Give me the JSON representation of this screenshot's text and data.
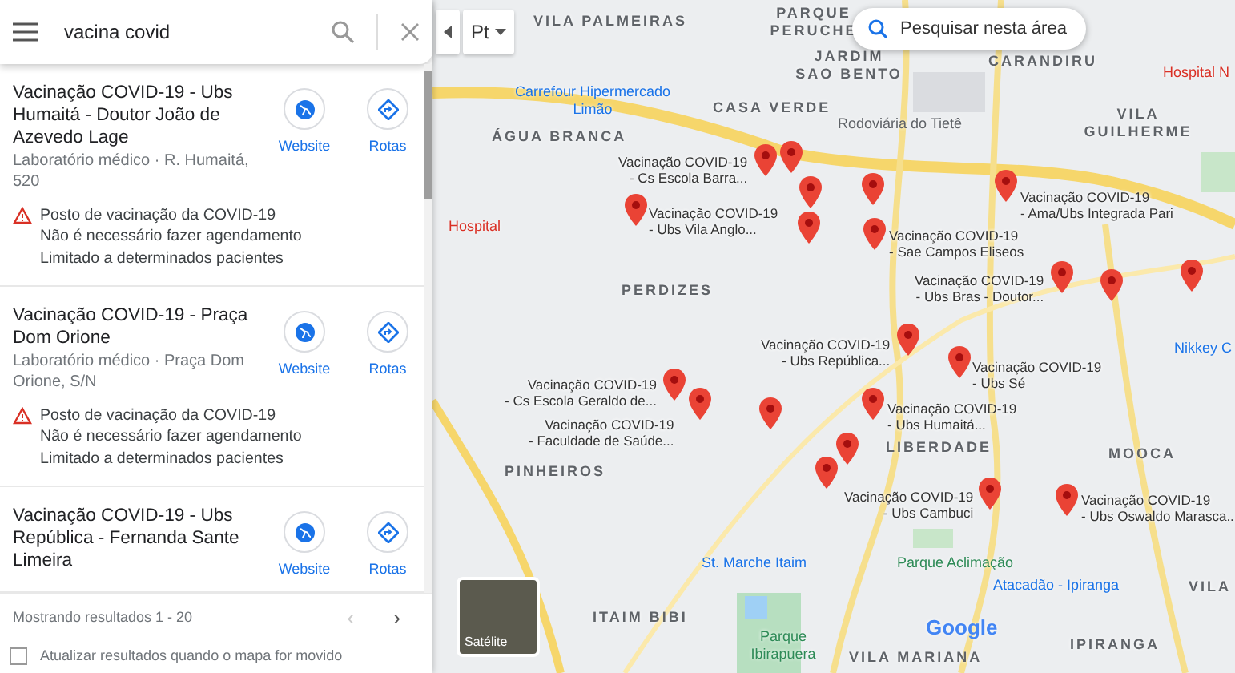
{
  "search": {
    "query": "vacina covid"
  },
  "results": [
    {
      "title": "Vacinação COVID-19 - Ubs Humaitá - Doutor João de Azevedo Lage",
      "subtitle": "Laboratório médico · R. Humaitá, 520",
      "notice": "Posto de vacinação da COVID-19",
      "details": [
        "Não é necessário fazer agendamento",
        "Limitado a determinados pacientes"
      ],
      "actions": [
        "Website",
        "Rotas"
      ]
    },
    {
      "title": "Vacinação COVID-19 - Praça Dom Orione",
      "subtitle": "Laboratório médico · Praça Dom Orione, S/N",
      "notice": "Posto de vacinação da COVID-19",
      "details": [
        "Não é necessário fazer agendamento",
        "Limitado a determinados pacientes"
      ],
      "actions": [
        "Website",
        "Rotas"
      ]
    },
    {
      "title": "Vacinação COVID-19 - Ubs República - Fernanda Sante Limeira",
      "actions": [
        "Website",
        "Rotas"
      ]
    }
  ],
  "pager": {
    "text": "Mostrando resultados 1 - 20",
    "prev": "‹",
    "prev_disabled": true,
    "next": "›",
    "next_disabled": false
  },
  "refresh_option": {
    "label": "Atualizar resultados quando o mapa for movido",
    "checked": false
  },
  "map": {
    "layer_label": "Pt",
    "search_area_button": "Pesquisar nesta área",
    "areas": [
      "VILA PALMEIRAS",
      "PARQUE PERUCHE",
      "JARDIM SAO BENTO",
      "CARANDIRU",
      "CASA VERDE",
      "ÁGUA BRANCA",
      "VILA GUILHERME",
      "PERDIZES",
      "LIBERDADE",
      "MOOCA",
      "PINHEIROS",
      "ITAIM BIBI",
      "VILA MARIANA",
      "IPIRANGA",
      "VILA"
    ],
    "places": [
      {
        "text": "Carrefour Hipermercado Limão",
        "kind": "shop"
      },
      {
        "text": "Rodoviária do Tietê",
        "kind": "transit"
      },
      {
        "text": "St. Marche Itaim",
        "kind": "shop"
      },
      {
        "text": "Atacadão - Ipiranga",
        "kind": "shop"
      },
      {
        "text": "Nikkey C",
        "kind": "shop"
      },
      {
        "text": "Parque Aclimação",
        "kind": "park"
      },
      {
        "text": "Parque Ibirapuera",
        "kind": "park"
      },
      {
        "text": "Hospital N",
        "kind": "hospital"
      },
      {
        "text": "Hospital",
        "kind": "hospital"
      }
    ],
    "markers": [
      {
        "label": "Vacinação COVID-19 - Cs Escola Barra..."
      },
      {
        "label": "Vacinação COVID-19 - Ubs Vila Anglo..."
      },
      {
        "label": "Vacinação COVID-19 - Sae Campos Eliseos"
      },
      {
        "label": "Vacinação COVID-19 - Ama/Ubs Integrada Pari"
      },
      {
        "label": "Vacinação COVID-19 - Ubs Bras - Doutor..."
      },
      {
        "label": "Vacinação COVID-19 - Ubs República..."
      },
      {
        "label": "Vacinação COVID-19 - Ubs Sé"
      },
      {
        "label": "Vacinação COVID-19 - Cs Escola Geraldo de..."
      },
      {
        "label": "Vacinação COVID-19 - Faculdade de Saúde..."
      },
      {
        "label": "Vacinação COVID-19 - Ubs Humaitá..."
      },
      {
        "label": "Vacinação COVID-19 - Ubs Cambuci"
      },
      {
        "label": "Vacinação COVID-19 - Ubs Oswaldo Marasca..."
      }
    ],
    "satellite_label": "Satélite",
    "logo": "Google"
  }
}
